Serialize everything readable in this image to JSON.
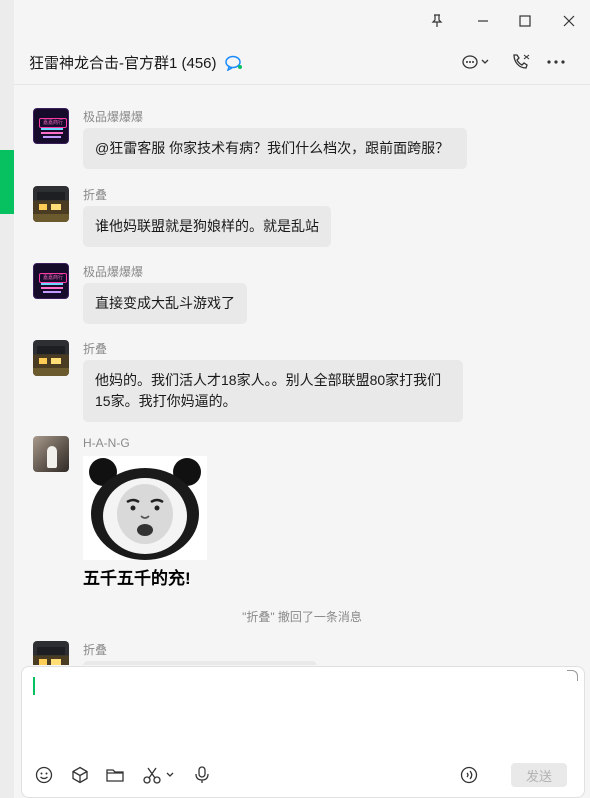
{
  "window": {
    "title": "狂雷神龙合击-官方群1 (456)",
    "controls": [
      "pin-icon",
      "minimize-icon",
      "maximize-icon",
      "close-icon"
    ]
  },
  "header": {
    "actions": [
      "chat-bubble-icon",
      "call-icon",
      "more-icon"
    ]
  },
  "messages": [
    {
      "sender": "极品爆爆爆",
      "avatar": "neon-sign-avatar",
      "text": "@狂雷客服   你家技术有病？我们什么档次，跟前面跨服？"
    },
    {
      "sender": "折叠",
      "avatar": "house-night-avatar",
      "text": "谁他妈联盟就是狗娘样的。就是乱站"
    },
    {
      "sender": "极品爆爆爆",
      "avatar": "neon-sign-avatar",
      "text": "直接变成大乱斗游戏了"
    },
    {
      "sender": "折叠",
      "avatar": "house-night-avatar",
      "text": "他妈的。我们活人才18家人。。别人全部联盟80家打我们15家。我打你妈逼的。"
    },
    {
      "sender": "H-A-N-G",
      "avatar": "photo-avatar",
      "sticker_caption": "五千五千的充!"
    },
    {
      "sender": "折叠",
      "avatar": "house-night-avatar"
    }
  ],
  "system_notice": "\"折叠\" 撤回了一条消息",
  "input": {
    "value": "",
    "send_label": "发送",
    "tools": [
      "emoji-icon",
      "sticker-box-icon",
      "folder-icon",
      "scissors-icon",
      "microphone-icon",
      "voice-input-icon"
    ]
  },
  "colors": {
    "accent": "#07c160",
    "bubble": "#e9e9e9",
    "background": "#f5f5f5"
  }
}
